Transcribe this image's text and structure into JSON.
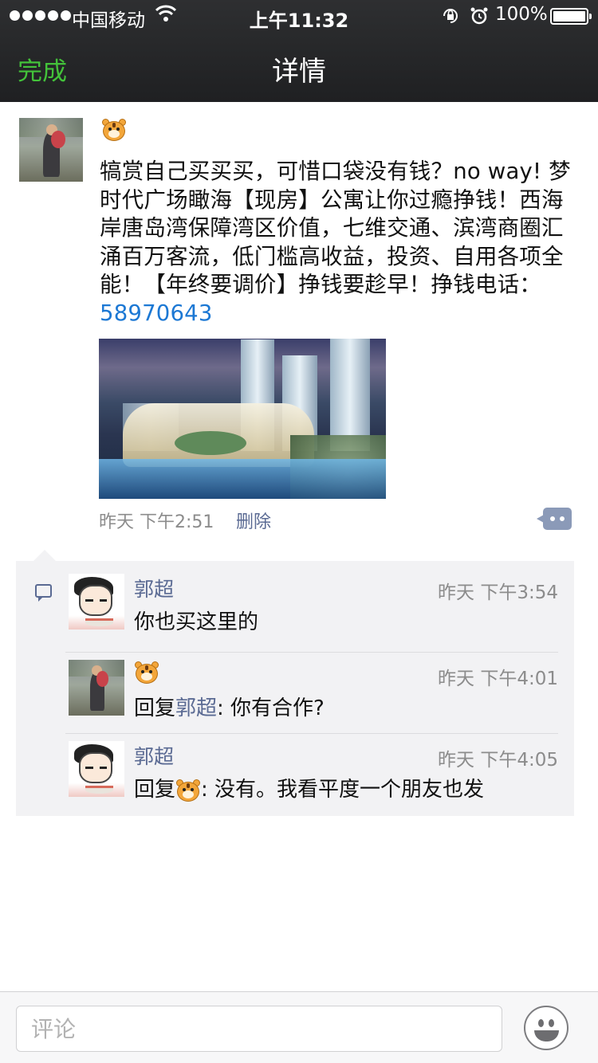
{
  "status_bar": {
    "carrier": "中国移动",
    "time": "上午11:32",
    "battery_percent": "100%",
    "battery_level": 1.0,
    "signal_bars": 5,
    "icons": [
      "signal-dots-icon",
      "wifi-icon",
      "rotation-lock-icon",
      "alarm-icon",
      "battery-icon"
    ]
  },
  "nav": {
    "done_label": "完成",
    "title": "详情"
  },
  "post": {
    "author_avatar": "photo-avatar",
    "author_name_icon": "tiger-emoji",
    "text_main": "犒赏自己买买买，可惜口袋没有钱？no way! 梦时代广场瞰海【现房】公寓让你过瘾挣钱！西海岸唐岛湾保障湾区价值，七维交通、滨湾商圈汇涌百万客流，低门槛高收益，投资、自用各项全能！【年终要调价】挣钱要趁早！挣钱电话：",
    "phone": "58970643",
    "image_description_icon": "building-rendering-image",
    "time": "昨天 下午2:51",
    "delete_label": "删除",
    "more_icon": "more-comment-icon"
  },
  "comments": {
    "section_icon": "comment-icon",
    "items": [
      {
        "name": "郭超",
        "time": "昨天 下午3:54",
        "text": "你也买这里的",
        "avatar": "cartoon-avatar"
      },
      {
        "name_icon": "tiger-emoji",
        "time": "昨天 下午4:01",
        "reply_prefix": "回复",
        "reply_to": "郭超",
        "text": ": 你有合作?",
        "avatar": "photo-avatar"
      },
      {
        "name": "郭超",
        "time": "昨天 下午4:05",
        "reply_prefix": "回复",
        "reply_to_icon": "tiger-emoji",
        "text": ": 没有。我看平度一个朋友也发",
        "avatar": "cartoon-avatar"
      }
    ]
  },
  "input": {
    "placeholder": "评论",
    "emoji_icon": "smiley-icon"
  },
  "colors": {
    "done_green": "#43c23a",
    "link_blue": "#1c78d4",
    "name_blue": "#5a6a93",
    "comment_bg": "#f2f2f4"
  }
}
